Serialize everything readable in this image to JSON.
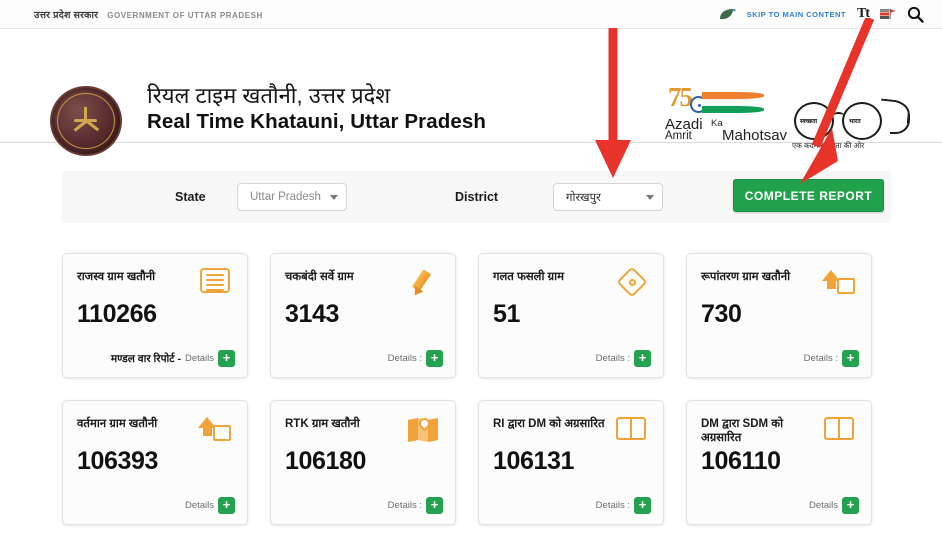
{
  "topbar": {
    "gov_hindi": "उत्तर प्रदेश सरकार",
    "gov_english": "GOVERNMENT OF UTTAR PRADESH",
    "skip_link": "SKIP TO MAIN CONTENT",
    "text_size_icon_label": "Tt",
    "icons": [
      "leaf-icon",
      "text-size-icon",
      "language-flag-icon",
      "search-icon"
    ]
  },
  "header": {
    "emblem_alt": "uttar-pradesh-government-emblem",
    "title_hindi": "रियल टाइम खतौनी, उत्तर प्रदेश",
    "title_english": "Real Time Khatauni, Uttar Pradesh",
    "azadi": {
      "num": "75",
      "line1": "Azadi",
      "line2": "Amrit",
      "ka": "Ka",
      "mahotsav": "Mahotsav"
    },
    "swachh": {
      "lens_left_text": "स्वच्छता",
      "lens_right_text": "भारत",
      "caption": "एक कदम स्वच्छता की ओर"
    }
  },
  "filters": {
    "state_label": "State",
    "state_value": "Uttar Pradesh",
    "district_label": "District",
    "district_value": "गोरखपुर",
    "report_button": "COMPLETE REPORT"
  },
  "cards": [
    {
      "title": "राजस्व ग्राम खतौनी",
      "value": "110266",
      "note": "मण्डल वार रिपोर्ट -",
      "details_label": "Details",
      "plus": "+",
      "icon": "list-icon"
    },
    {
      "title": "चकबंदी सर्वे ग्राम",
      "value": "3143",
      "note": "",
      "details_label": "Details :",
      "plus": "+",
      "icon": "pencil-icon"
    },
    {
      "title": "गलत फसली ग्राम",
      "value": "51",
      "note": "",
      "details_label": "Details :",
      "plus": "+",
      "icon": "diamond-node-icon"
    },
    {
      "title": "रूपांतरण ग्राम खतौनी",
      "value": "730",
      "note": "",
      "details_label": "Details :",
      "plus": "+",
      "icon": "convert-icon"
    },
    {
      "title": "वर्तमान ग्राम खतौनी",
      "value": "106393",
      "note": "",
      "details_label": "Details",
      "plus": "+",
      "icon": "convert-icon"
    },
    {
      "title": "RTK ग्राम खतौनी",
      "value": "106180",
      "note": "",
      "details_label": "Details :",
      "plus": "+",
      "icon": "map-pin-icon"
    },
    {
      "title": "RI द्वारा DM को अग्रसारित",
      "value": "106131",
      "note": "",
      "details_label": "Details :",
      "plus": "+",
      "icon": "book-icon"
    },
    {
      "title": "DM द्वारा SDM को अग्रसारित",
      "value": "106110",
      "note": "",
      "details_label": "Details",
      "plus": "+",
      "icon": "book-icon"
    }
  ],
  "annotations": {
    "arrow_color": "#e8332a",
    "arrow_1_target": "district-select",
    "arrow_2_target": "complete-report-button"
  },
  "colors": {
    "green_button": "#21a14b",
    "green_plus": "#24a24d",
    "icon_orange": "#f0a53a",
    "skip_link_blue": "#2f7fd4",
    "arrow_red": "#e8332a"
  }
}
